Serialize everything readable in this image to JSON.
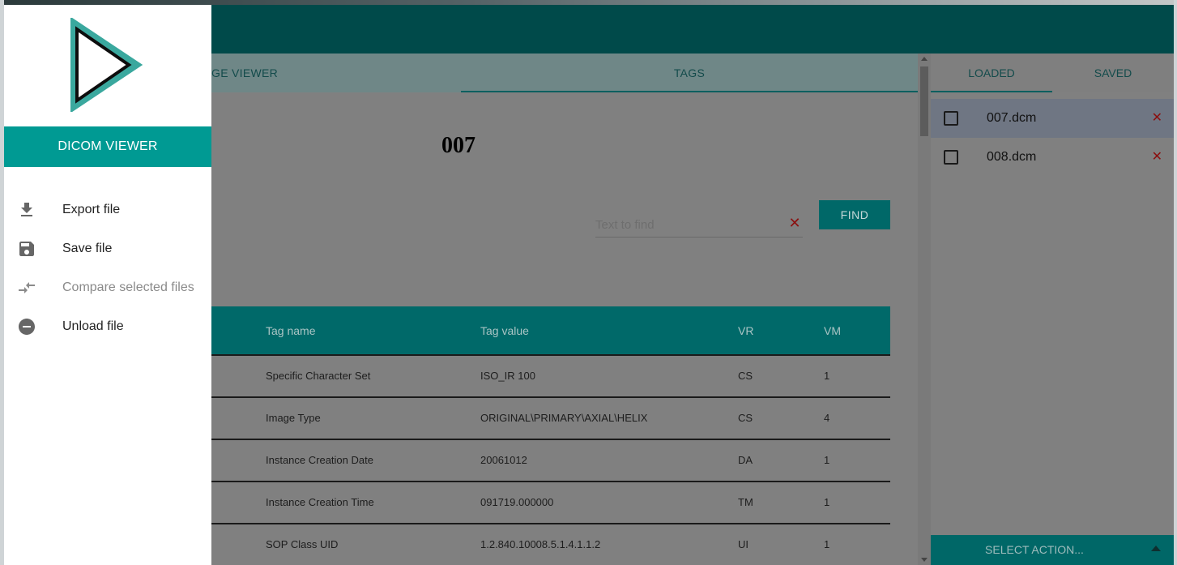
{
  "drawer": {
    "title": "DICOM VIEWER",
    "menu": [
      {
        "label": "Export file",
        "icon": "download-icon",
        "enabled": true
      },
      {
        "label": "Save file",
        "icon": "save-icon",
        "enabled": true
      },
      {
        "label": "Compare selected files",
        "icon": "compare-arrows-icon",
        "enabled": false
      },
      {
        "label": "Unload file",
        "icon": "remove-circle-icon",
        "enabled": true
      }
    ]
  },
  "tabs": [
    {
      "label": "GE VIEWER"
    },
    {
      "label": "TAGS",
      "active": true
    }
  ],
  "main": {
    "file_title": "007",
    "search": {
      "placeholder": "Text to find",
      "value": "",
      "clear_icon": "close-icon"
    },
    "find_label": "FIND"
  },
  "table": {
    "headers": {
      "tag_name": "Tag name",
      "tag_value": "Tag value",
      "vr": "VR",
      "vm": "VM"
    },
    "rows": [
      {
        "tag_name": "Specific Character Set",
        "tag_value": "ISO_IR 100",
        "vr": "CS",
        "vm": "1"
      },
      {
        "tag_name": "Image Type",
        "tag_value": "ORIGINAL\\PRIMARY\\AXIAL\\HELIX",
        "vr": "CS",
        "vm": "4"
      },
      {
        "tag_name": "Instance Creation Date",
        "tag_value": "20061012",
        "vr": "DA",
        "vm": "1"
      },
      {
        "tag_name": "Instance Creation Time",
        "tag_value": "091719.000000",
        "vr": "TM",
        "vm": "1"
      },
      {
        "tag_name": "SOP Class UID",
        "tag_value": "1.2.840.10008.5.1.4.1.1.2",
        "vr": "UI",
        "vm": "1"
      }
    ]
  },
  "right_panel": {
    "tabs": [
      {
        "label": "LOADED",
        "active": true
      },
      {
        "label": "SAVED"
      }
    ],
    "files": [
      {
        "name": "007.dcm",
        "checked": false,
        "selected": true
      },
      {
        "name": "008.dcm",
        "checked": false,
        "selected": false
      }
    ],
    "select_action": "SELECT ACTION..."
  },
  "colors": {
    "brand_teal": "#009a93",
    "header_teal": "#004a4a",
    "delete_red": "#8b0f0f"
  }
}
